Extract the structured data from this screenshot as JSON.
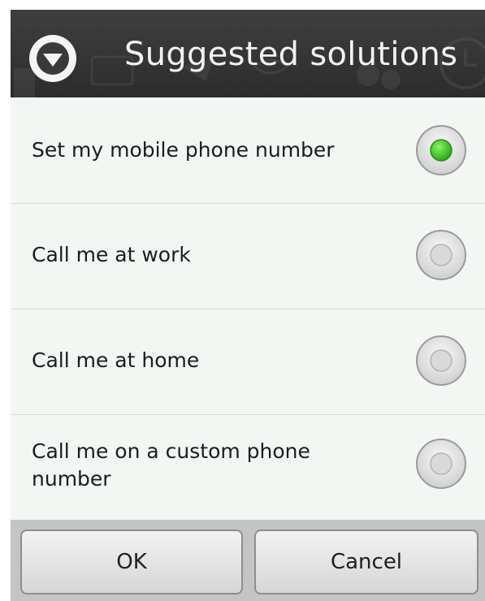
{
  "dialog": {
    "title": "Suggested solutions",
    "title_icon": "chevron-down-circle-icon"
  },
  "options": [
    {
      "label": "Set my mobile phone number",
      "selected": true
    },
    {
      "label": "Call me at work",
      "selected": false
    },
    {
      "label": "Call me at home",
      "selected": false
    },
    {
      "label": "Call me on a custom phone number",
      "selected": false
    }
  ],
  "buttons": {
    "ok_label": "OK",
    "cancel_label": "Cancel"
  },
  "colors": {
    "title_bar": "#333333",
    "selected_radio": "#39c21b",
    "background": "#f3f7f4"
  }
}
